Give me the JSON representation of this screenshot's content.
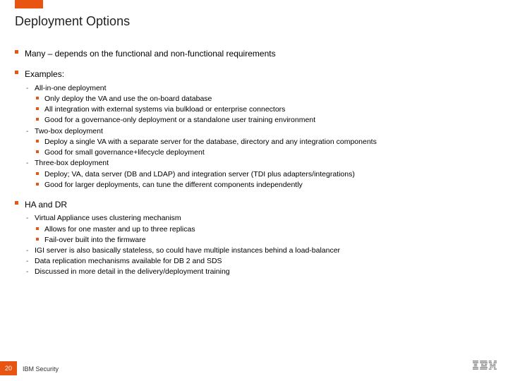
{
  "title": "Deployment Options",
  "sections": [
    {
      "label": "Many – depends on the functional and non-functional requirements"
    },
    {
      "label": "Examples:",
      "items": [
        {
          "label": "All-in-one deployment",
          "subitems": [
            "Only deploy the VA and use the on-board database",
            "All integration with external systems via bulkload or enterprise connectors",
            "Good for a governance-only deployment or a standalone user training environment"
          ]
        },
        {
          "label": "Two-box deployment",
          "subitems": [
            "Deploy a single VA with a separate server for the database, directory and any integration components",
            "Good for small governance+lifecycle deployment"
          ]
        },
        {
          "label": "Three-box deployment",
          "subitems": [
            "Deploy; VA, data server (DB and LDAP) and integration server (TDI plus adapters/integrations)",
            "Good for larger deployments, can tune the different components independently"
          ]
        }
      ]
    },
    {
      "label": "HA and DR",
      "items": [
        {
          "label": "Virtual Appliance uses clustering mechanism",
          "subitems": [
            "Allows for one master and up to three replicas",
            "Fail-over built into the firmware"
          ]
        },
        {
          "label": "IGI server is also basically stateless, so could have multiple instances behind a load-balancer"
        },
        {
          "label": "Data replication mechanisms available for DB 2 and SDS"
        },
        {
          "label": "Discussed in more detail in the delivery/deployment training"
        }
      ]
    }
  ],
  "footer": {
    "page": "20",
    "label": "IBM Security"
  }
}
